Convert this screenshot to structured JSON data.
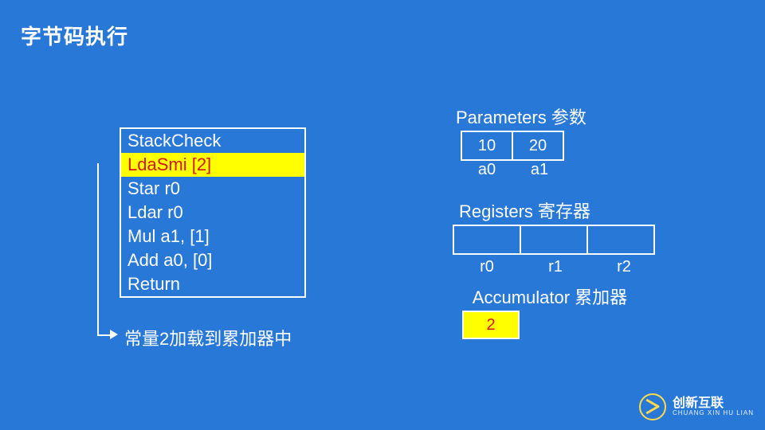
{
  "title": "字节码执行",
  "bytecode": {
    "active_index": 1,
    "lines": [
      "StackCheck",
      "LdaSmi [2]",
      "Star r0",
      "Ldar r0",
      "Mul a1, [1]",
      "Add a0, [0]",
      "Return"
    ]
  },
  "annotation": "常量2加载到累加器中",
  "parameters": {
    "heading": "Parameters 参数",
    "cells": [
      "10",
      "20"
    ],
    "labels": [
      "a0",
      "a1"
    ]
  },
  "registers": {
    "heading": "Registers 寄存器",
    "cells": [
      "",
      "",
      ""
    ],
    "labels": [
      "r0",
      "r1",
      "r2"
    ]
  },
  "accumulator": {
    "heading": "Accumulator 累加器",
    "value": "2"
  },
  "footer": {
    "brand_zh": "创新互联",
    "brand_en": "CHUANG XIN HU LIAN"
  },
  "colors": {
    "bg": "#2878d7",
    "highlight_bg": "#ffff00",
    "highlight_fg": "#d01818",
    "line": "#ffffff"
  }
}
